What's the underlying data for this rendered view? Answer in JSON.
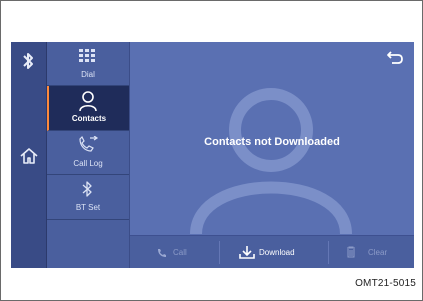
{
  "menu": {
    "items": [
      {
        "label": "Dial",
        "icon": "dialpad-icon"
      },
      {
        "label": "Contacts",
        "icon": "person-icon",
        "active": true
      },
      {
        "label": "Call Log",
        "icon": "call-log-icon"
      },
      {
        "label": "BT Set",
        "icon": "bluetooth-icon"
      }
    ]
  },
  "main": {
    "message": "Contacts not Downloaded"
  },
  "bottom_bar": {
    "call_label": "Call",
    "download_label": "Download",
    "clear_label": "Clear"
  },
  "caption": "OMT21-5015",
  "colors": {
    "screen_dark": "#394b86",
    "menu": "#4a5f9e",
    "menu_active": "#1f2c5a",
    "active_accent": "#ff8a3d",
    "main": "#5a70b2"
  }
}
